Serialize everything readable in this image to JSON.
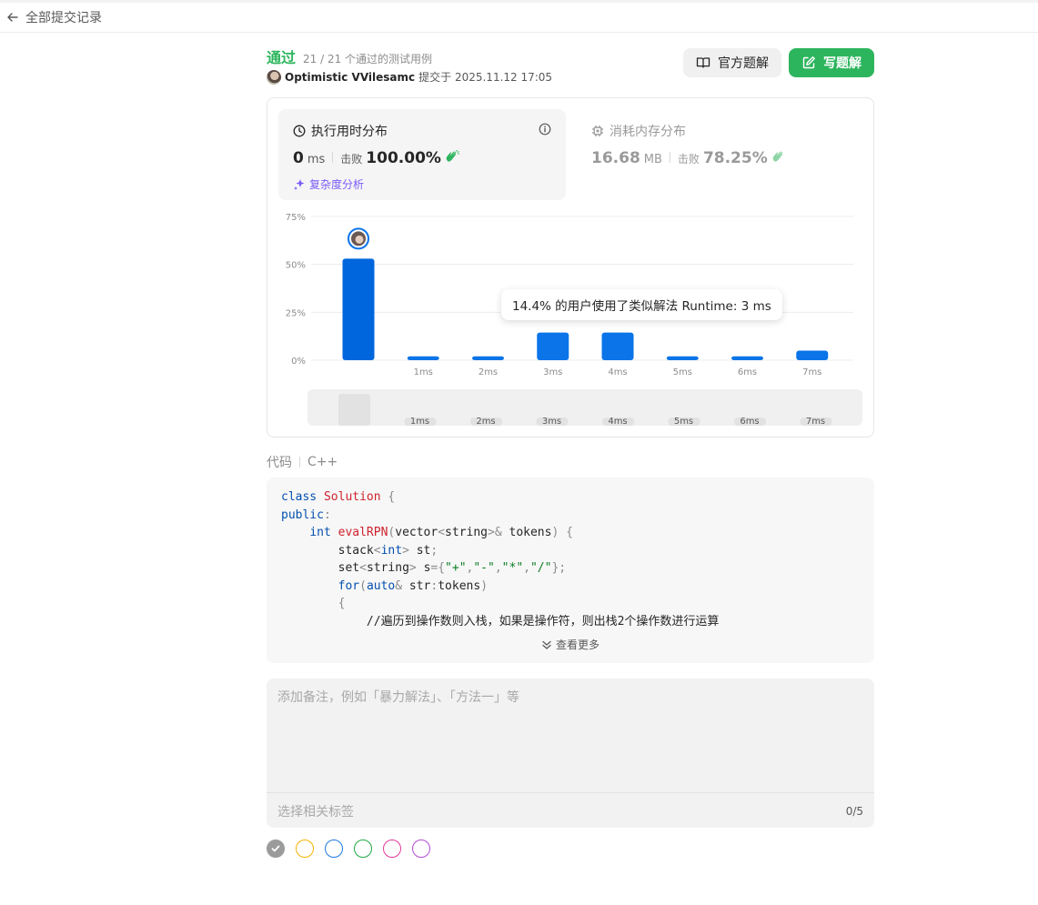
{
  "nav": {
    "back_label": "全部提交记录"
  },
  "submission": {
    "status": "通过",
    "tests": "21 / 21 个通过的测试用例",
    "author": "Optimistic VVilesamc",
    "submitted_at": "提交于 2025.11.12 17:05"
  },
  "actions": {
    "official_label": "官方题解",
    "write_label": "写题解"
  },
  "runtime": {
    "title": "执行用时分布",
    "value": "0",
    "unit": "ms",
    "beats_label": "击败",
    "beats": "100.00%",
    "analysis_label": "复杂度分析"
  },
  "memory": {
    "title": "消耗内存分布",
    "value": "16.68",
    "unit": "MB",
    "beats_label": "击败",
    "beats": "78.25%"
  },
  "chart_data": {
    "type": "bar",
    "categories": [
      "0ms",
      "1ms",
      "2ms",
      "3ms",
      "4ms",
      "5ms",
      "6ms",
      "7ms"
    ],
    "tick_labels": [
      "",
      "1ms",
      "2ms",
      "3ms",
      "4ms",
      "5ms",
      "6ms",
      "7ms"
    ],
    "values": [
      53,
      2,
      2,
      14.4,
      14.4,
      2,
      2,
      5
    ],
    "y_ticks": [
      "0%",
      "25%",
      "50%",
      "75%"
    ],
    "ylim": [
      0,
      75
    ],
    "highlight_index": 0,
    "tooltip": "14.4% 的用户使用了类似解法 Runtime: 3 ms",
    "bar_color": "#0a74e8",
    "highlight_color": "#0066dd",
    "grid": true
  },
  "code": {
    "label": "代码",
    "language": "C++",
    "lines": [
      "class Solution {",
      "public:",
      "    int evalRPN(vector<string>& tokens) {",
      "        stack<int> st;",
      "        set<string> s={\"+\",\"-\",\"*\",\"/\"};",
      "        for(auto& str:tokens)",
      "        {",
      "            //遍历到操作数则入栈，如果是操作符，则出栈2个操作数进行运算"
    ],
    "more_label": "查看更多"
  },
  "note": {
    "placeholder": "添加备注，例如「暴力解法」、「方法一」等",
    "tags_placeholder": "选择相关标签",
    "tag_count": "0/5"
  },
  "colors": [
    "#9b9b9b",
    "#f5b301",
    "#1e7be0",
    "#21a845",
    "#e13a9d",
    "#b44bd3"
  ]
}
